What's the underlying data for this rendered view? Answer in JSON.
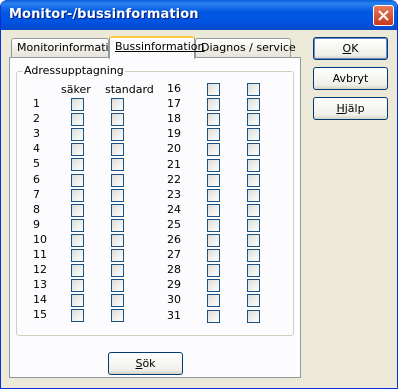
{
  "window": {
    "title": "Monitor-/bussinformation"
  },
  "tabs": [
    {
      "label": "Monitorinformation",
      "active": false
    },
    {
      "label": "Bussinformation",
      "active": true
    },
    {
      "label": "Diagnos / service",
      "active": false
    }
  ],
  "group": {
    "title": "Adressupptagning",
    "col_headers": [
      "säker",
      "standard"
    ],
    "left_addresses": [
      "1",
      "2",
      "3",
      "4",
      "5",
      "6",
      "7",
      "8",
      "9",
      "10",
      "11",
      "12",
      "13",
      "14",
      "15"
    ],
    "right_addresses": [
      "16",
      "17",
      "18",
      "19",
      "20",
      "21",
      "22",
      "23",
      "24",
      "25",
      "26",
      "27",
      "28",
      "29",
      "30",
      "31"
    ]
  },
  "buttons": {
    "ok": {
      "pre": "",
      "key": "O",
      "post": "K"
    },
    "cancel": {
      "label": "Avbryt"
    },
    "help": {
      "pre": "",
      "key": "H",
      "post": "jälp"
    },
    "search": {
      "pre": "",
      "key": "S",
      "post": "ök"
    }
  },
  "colors": {
    "titlebar": "#0054e3",
    "dialog_bg": "#ece9d8",
    "panel_bg": "#fcfcfe",
    "active_tab_accent": "#ffc83c"
  },
  "icons": {
    "close": "close-icon"
  }
}
